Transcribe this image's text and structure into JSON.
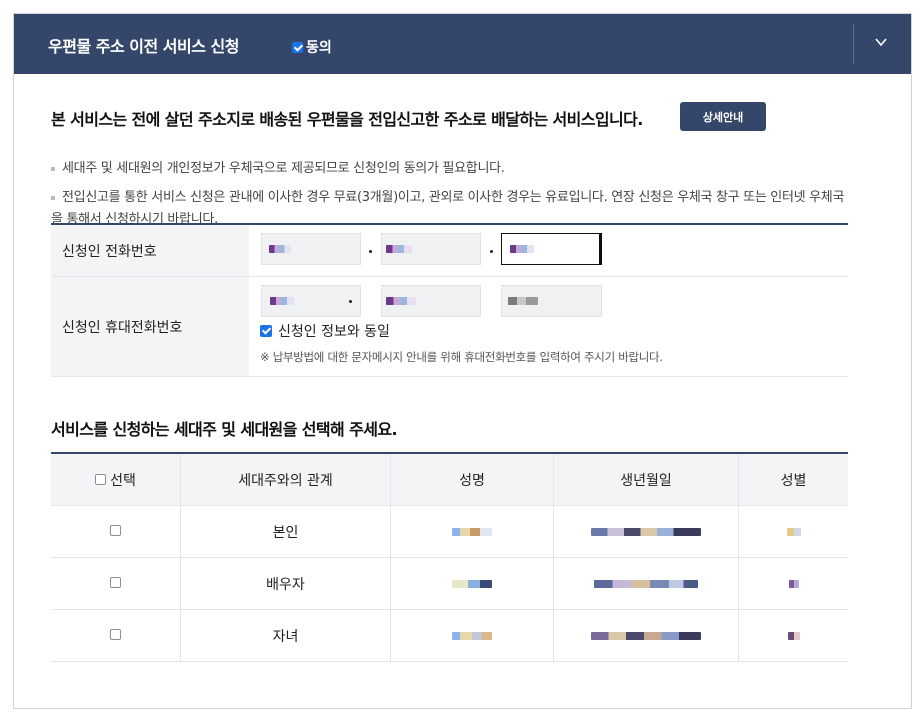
{
  "header": {
    "title": "우편물 주소 이전 서비스 신청",
    "agree_label": "동의"
  },
  "intro": {
    "text": "본 서비스는 전에 살던 주소지로 배송된 우편물을 전입신고한 주소로 배달하는 서비스입니다.",
    "detail_button": "상세안내"
  },
  "notes": [
    "세대주 및 세대원의 개인정보가 우체국으로 제공되므로 신청인의 동의가 필요합니다.",
    "전입신고를 통한 서비스 신청은 관내에 이사한 경우 무료(3개월)이고, 관외로 이사한 경우는 유료입니다. 연장 신청은 우체국 창구 또는 인터넷 우체국을 통해서 신청하시기 바랍니다."
  ],
  "form": {
    "phone_label": "신청인 전화번호",
    "mobile_label": "신청인 휴대전화번호",
    "same_as_applicant_label": "신청인 정보와 동일",
    "mobile_hint": "※ 납부방법에 대한 문자메시지 안내를 위해 휴대전화번호를 입력하여 주시기 바랍니다."
  },
  "household": {
    "title": "서비스를 신청하는 세대주 및 세대원을 선택해 주세요.",
    "columns": [
      "선택",
      "세대주와의 관계",
      "성명",
      "생년월일",
      "성별"
    ],
    "rows": [
      {
        "relation": "본인"
      },
      {
        "relation": "배우자"
      },
      {
        "relation": "자녀"
      }
    ]
  },
  "colors": {
    "header_bg": "#34476b",
    "accent": "#1a73e8"
  },
  "icons": {
    "collapse": "chevron-down-icon",
    "agree": "checkbox-checked-icon"
  }
}
